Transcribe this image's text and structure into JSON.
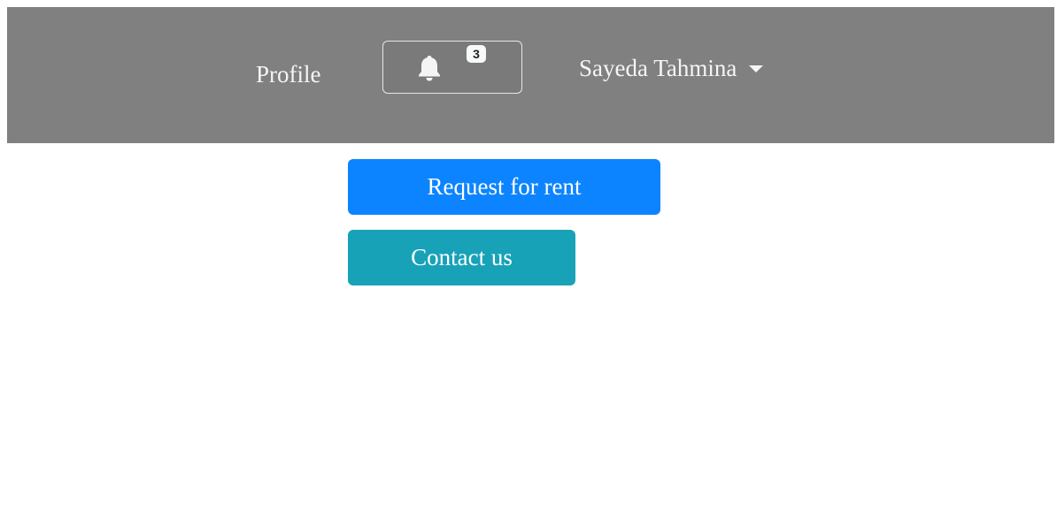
{
  "navbar": {
    "profile_label": "Profile",
    "notifications": {
      "icon": "bell-icon",
      "count": "3"
    },
    "user_name": "Sayeda Tahmina",
    "user_caret_icon": "caret-down-icon"
  },
  "actions": {
    "request_rent_label": "Request for rent",
    "contact_label": "Contact us"
  },
  "colors": {
    "navbar_bg": "#808080",
    "primary": "#0d84ff",
    "info": "#17a2b8"
  }
}
